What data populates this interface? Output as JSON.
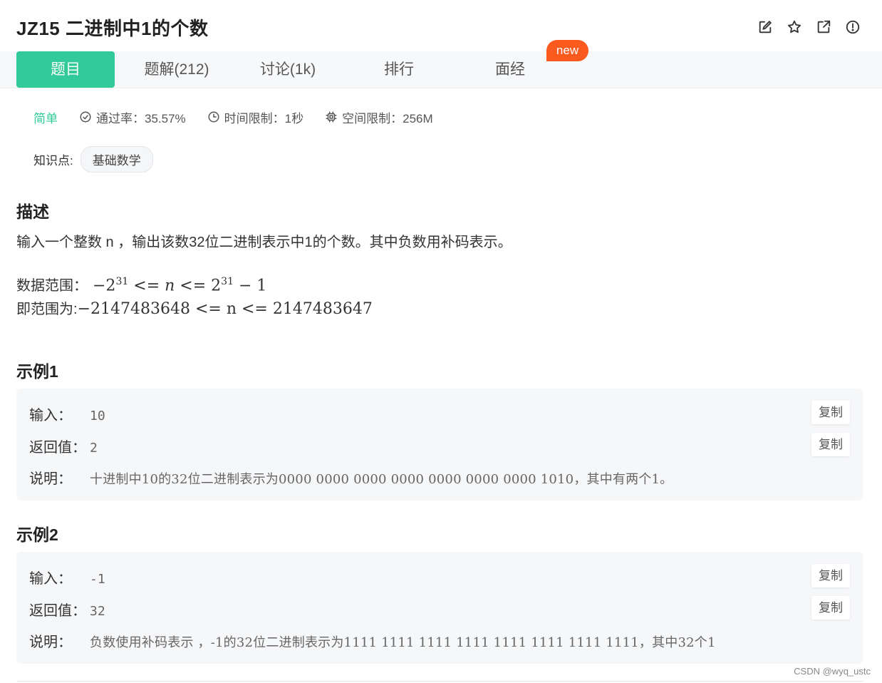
{
  "header": {
    "title": "JZ15  二进制中1的个数",
    "icons": [
      "edit-icon",
      "star-icon",
      "share-icon",
      "info-icon"
    ]
  },
  "tabs": [
    {
      "label": "题目",
      "active": true
    },
    {
      "label": "题解(212)",
      "active": false
    },
    {
      "label": "讨论(1k)",
      "active": false
    },
    {
      "label": "排行",
      "active": false
    },
    {
      "label": "面经",
      "active": false
    }
  ],
  "new_badge": "new",
  "meta": {
    "difficulty": "简单",
    "pass_rate": "通过率：35.57%",
    "time_limit": "时间限制：1秒",
    "space_limit": "空间限制：256M"
  },
  "knowledge": {
    "label": "知识点:",
    "tag": "基础数学"
  },
  "description": {
    "heading": "描述",
    "text": "输入一个整数 n ，输出该数32位二进制表示中1的个数。其中负数用补码表示。",
    "range_label_1": "数据范围：",
    "range_label_2": "即范围为:",
    "range_expr_2": "−2147483648 <= n <= 2147483647"
  },
  "examples": [
    {
      "heading": "示例1",
      "input_label": "输入：",
      "input_value": "10",
      "return_label": "返回值：",
      "return_value": "2",
      "note_label": "说明：",
      "note_value": "十进制中10的32位二进制表示为0000 0000 0000 0000 0000 0000 0000 1010，其中有两个1。",
      "copy_label": "复制"
    },
    {
      "heading": "示例2",
      "input_label": "输入：",
      "input_value": "-1",
      "return_label": "返回值：",
      "return_value": "32",
      "note_label": "说明：",
      "note_value": "负数使用补码表示 ，-1的32位二进制表示为1111 1111 1111 1111 1111 1111 1111 1111，其中32个1",
      "copy_label": "复制"
    }
  ],
  "watermark": "CSDN @wyq_ustc",
  "colors": {
    "accent": "#32ca99",
    "badge": "#fa5a1e",
    "tabbar_bg": "#f7f8fa",
    "example_bg": "#f6f7f9"
  }
}
